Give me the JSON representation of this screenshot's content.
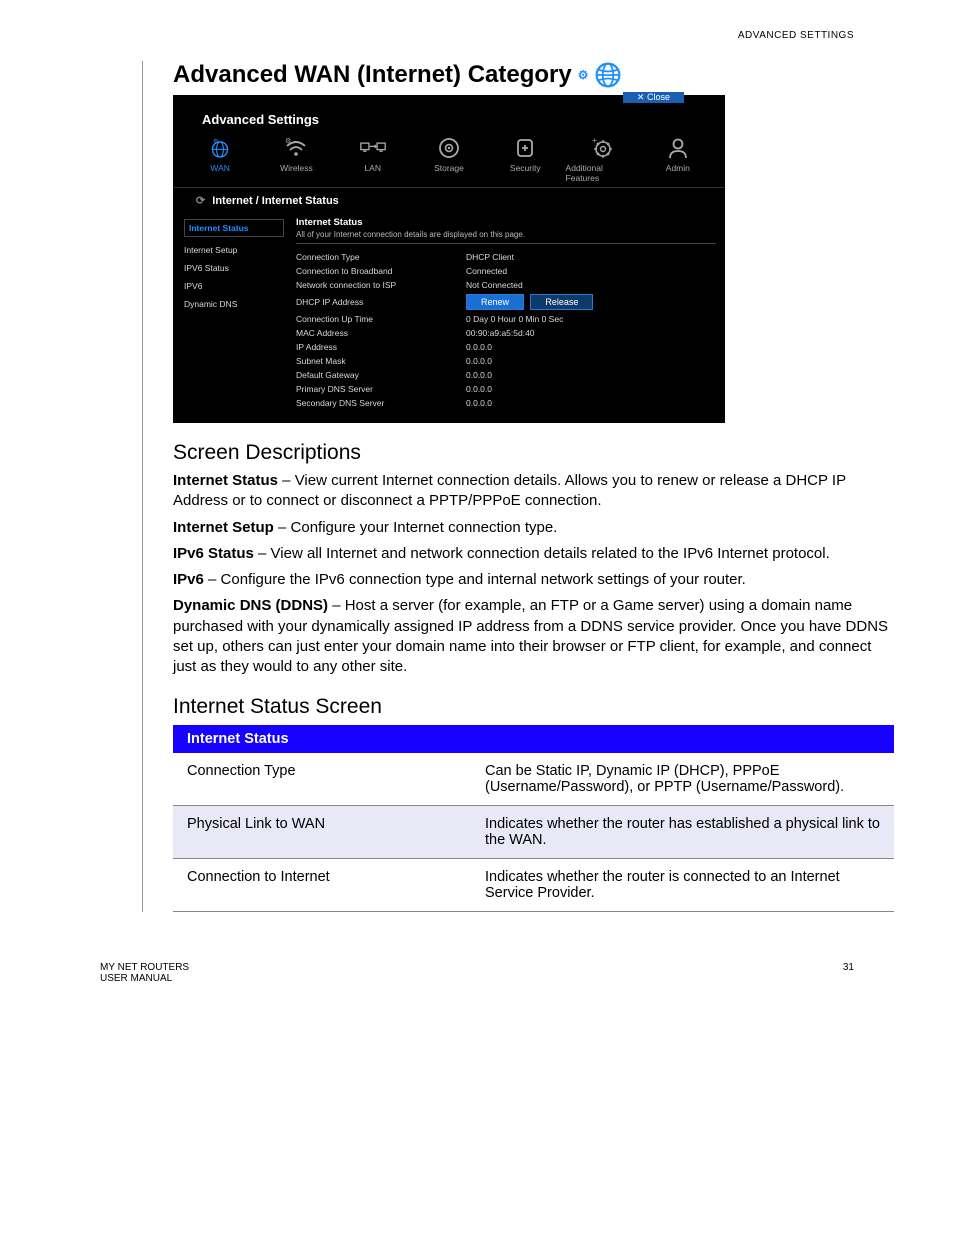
{
  "header": {
    "section": "ADVANCED SETTINGS"
  },
  "title": "Advanced WAN (Internet) Category",
  "screenshot": {
    "close": "Close",
    "app_title": "Advanced Settings",
    "tabs": [
      "WAN",
      "Wireless",
      "LAN",
      "Storage",
      "Security",
      "Additional Features",
      "Admin"
    ],
    "breadcrumb": "Internet / Internet Status",
    "side": [
      "Internet Status",
      "Internet Setup",
      "IPV6 Status",
      "IPV6",
      "Dynamic DNS"
    ],
    "panel_title": "Internet Status",
    "panel_sub": "All of your Internet connection details are displayed on this page.",
    "rows": [
      {
        "l": "Connection Type",
        "v": "DHCP Client"
      },
      {
        "l": "Connection to Broadband",
        "v": "Connected"
      },
      {
        "l": "Network connection to ISP",
        "v": "Not Connected"
      },
      {
        "l": "DHCP IP Address",
        "v": ""
      },
      {
        "l": "Connection Up Time",
        "v": "0 Day 0 Hour 0 Min 0 Sec"
      },
      {
        "l": "MAC Address",
        "v": "00:90:a9:a5:5d:40"
      },
      {
        "l": "IP Address",
        "v": "0.0.0.0"
      },
      {
        "l": "Subnet Mask",
        "v": "0.0.0.0"
      },
      {
        "l": "Default Gateway",
        "v": "0.0.0.0"
      },
      {
        "l": "Primary DNS Server",
        "v": "0.0.0.0"
      },
      {
        "l": "Secondary DNS Server",
        "v": "0.0.0.0"
      }
    ],
    "btn_renew": "Renew",
    "btn_release": "Release"
  },
  "sd_title": "Screen Descriptions",
  "sd": {
    "is_b": "Internet Status",
    "is_t": " – View current Internet connection details. Allows you to renew or release a DHCP IP Address or to connect or disconnect a PPTP/PPPoE connection.",
    "setup_b": "Internet Setup",
    "setup_t": " – Configure your Internet connection type.",
    "v6s_b": "IPv6 Status",
    "v6s_t": " – View all Internet and network connection details related to the IPv6 Internet protocol.",
    "v6_b": "IPv6",
    "v6_t": " – Configure the IPv6 connection type and internal network settings of your router.",
    "ddns_b": "Dynamic DNS (DDNS)",
    "ddns_t": " – Host a server (for example, an FTP or a Game server) using a domain name purchased with your dynamically assigned IP address from a DDNS service provider. Once you have DDNS set up, others can just enter your domain name into their browser or FTP client, for example, and connect just as they would to any other site."
  },
  "iss_title": "Internet Status Screen",
  "table": {
    "header": "Internet Status",
    "rows": [
      {
        "l": "Connection Type",
        "d": "Can be Static IP, Dynamic IP (DHCP), PPPoE (Username/Password), or PPTP (Username/Password)."
      },
      {
        "l": "Physical Link to WAN",
        "d": "Indicates whether the router has established a physical link to the WAN."
      },
      {
        "l": "Connection to Internet",
        "d": "Indicates whether the router is connected to an Internet Service Provider."
      }
    ]
  },
  "footer": {
    "left1": "MY NET ROUTERS",
    "left2": "USER MANUAL",
    "page": "31"
  }
}
